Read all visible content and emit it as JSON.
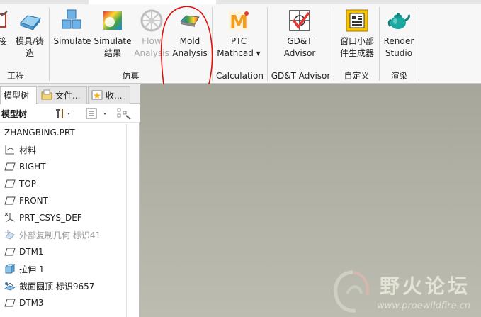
{
  "ribbon": {
    "buttons": [
      {
        "id": "jie",
        "label": "接",
        "icon": "partial-icon"
      },
      {
        "id": "mold-cast",
        "label": "模具/铸\n造",
        "icon": "mold-cast-icon"
      },
      {
        "id": "simulate",
        "label": "Simulate",
        "icon": "simulate-cubes-icon"
      },
      {
        "id": "simulate-results",
        "label": "Simulate\n结果",
        "icon": "simulate-results-icon"
      },
      {
        "id": "flow-analysis",
        "label": "Flow\nAnalysis",
        "icon": "flow-analysis-icon",
        "disabled": true
      },
      {
        "id": "mold-analysis",
        "label": "Mold\nAnalysis",
        "icon": "mold-analysis-icon"
      },
      {
        "id": "ptc-mathcad",
        "label": "PTC\nMathcad ▾",
        "icon": "mathcad-icon"
      },
      {
        "id": "gdt-advisor",
        "label": "GD&T\nAdvisor",
        "icon": "gdt-advisor-icon"
      },
      {
        "id": "widget-generator",
        "label": "窗口小部\n件生成器",
        "icon": "widget-generator-icon"
      },
      {
        "id": "render-studio",
        "label": "Render\nStudio",
        "icon": "teapot-icon"
      }
    ],
    "groups": [
      {
        "label": "工程"
      },
      {
        "label": "仿真"
      },
      {
        "label": "Calculation"
      },
      {
        "label": "GD&T Advisor"
      },
      {
        "label": "自定义"
      },
      {
        "label": "渲染"
      }
    ]
  },
  "panel": {
    "tabs": [
      {
        "label": "模型树",
        "active": true
      },
      {
        "label": "文件..."
      },
      {
        "label": "收..."
      }
    ],
    "toolbar_title": "模型树",
    "tree": [
      {
        "label": "ZHANGBING.PRT",
        "icon": "none",
        "root": true
      },
      {
        "label": "材料",
        "icon": "material-icon"
      },
      {
        "label": "RIGHT",
        "icon": "datum-plane-icon"
      },
      {
        "label": "TOP",
        "icon": "datum-plane-icon"
      },
      {
        "label": "FRONT",
        "icon": "datum-plane-icon"
      },
      {
        "label": "PRT_CSYS_DEF",
        "icon": "csys-icon"
      },
      {
        "label": "外部复制几何 标识41",
        "icon": "external-copy-icon",
        "disabled": true
      },
      {
        "label": "DTM1",
        "icon": "datum-plane-icon"
      },
      {
        "label": "拉伸 1",
        "icon": "extrude-icon"
      },
      {
        "label": "截面圆顶 标识9657",
        "icon": "section-dome-icon"
      },
      {
        "label": "DTM3",
        "icon": "datum-plane-icon"
      }
    ]
  },
  "watermark": {
    "title": "野火论坛",
    "url": "www.proewildfire.cn"
  }
}
